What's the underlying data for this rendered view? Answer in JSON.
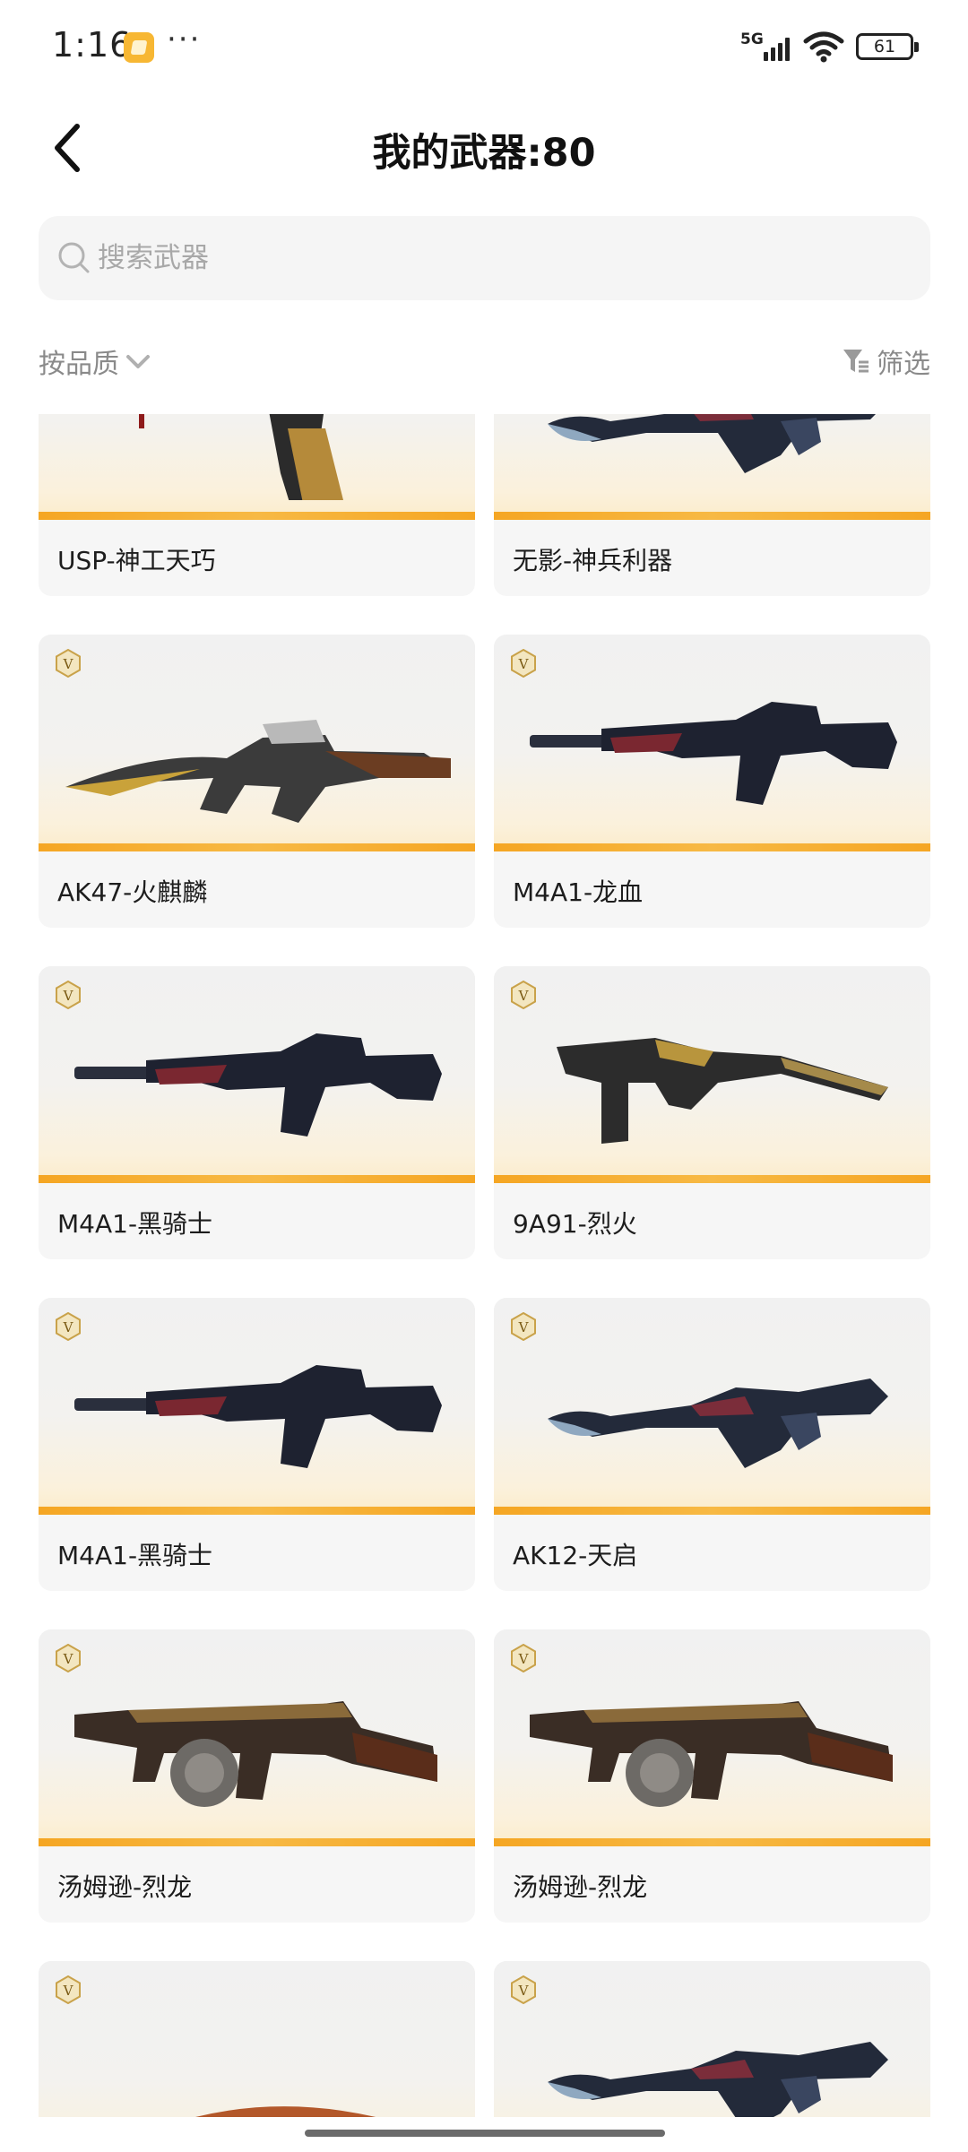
{
  "status_bar": {
    "time": "1:16",
    "more": "···",
    "network": "5G",
    "battery": "61"
  },
  "header": {
    "title": "我的武器:80"
  },
  "search": {
    "placeholder": "搜索武器"
  },
  "filters": {
    "sort_label": "按品质",
    "filter_label": "筛选"
  },
  "colors": {
    "accent": "#f5a623",
    "card_bg": "#f6f6f6",
    "badge_gold": "#c9a24a"
  },
  "weapons": [
    {
      "name": "USP-神工天巧",
      "badge": false,
      "icon": "pistol-icon"
    },
    {
      "name": "无影-神兵利器",
      "badge": false,
      "icon": "assault-rifle-icon"
    },
    {
      "name": "AK47-火麒麟",
      "badge": true,
      "icon": "ak47-icon"
    },
    {
      "name": "M4A1-龙血",
      "badge": true,
      "icon": "m4a1-icon"
    },
    {
      "name": "M4A1-黑骑士",
      "badge": true,
      "icon": "m4a1-icon"
    },
    {
      "name": "9A91-烈火",
      "badge": true,
      "icon": "smg-icon"
    },
    {
      "name": "M4A1-黑骑士",
      "badge": true,
      "icon": "m4a1-icon"
    },
    {
      "name": "AK12-天启",
      "badge": true,
      "icon": "assault-rifle-icon"
    },
    {
      "name": "汤姆逊-烈龙",
      "badge": true,
      "icon": "thompson-icon"
    },
    {
      "name": "汤姆逊-烈龙",
      "badge": true,
      "icon": "thompson-icon"
    },
    {
      "name": "",
      "badge": true,
      "icon": "knife-icon"
    },
    {
      "name": "",
      "badge": true,
      "icon": "assault-rifle-icon"
    }
  ]
}
